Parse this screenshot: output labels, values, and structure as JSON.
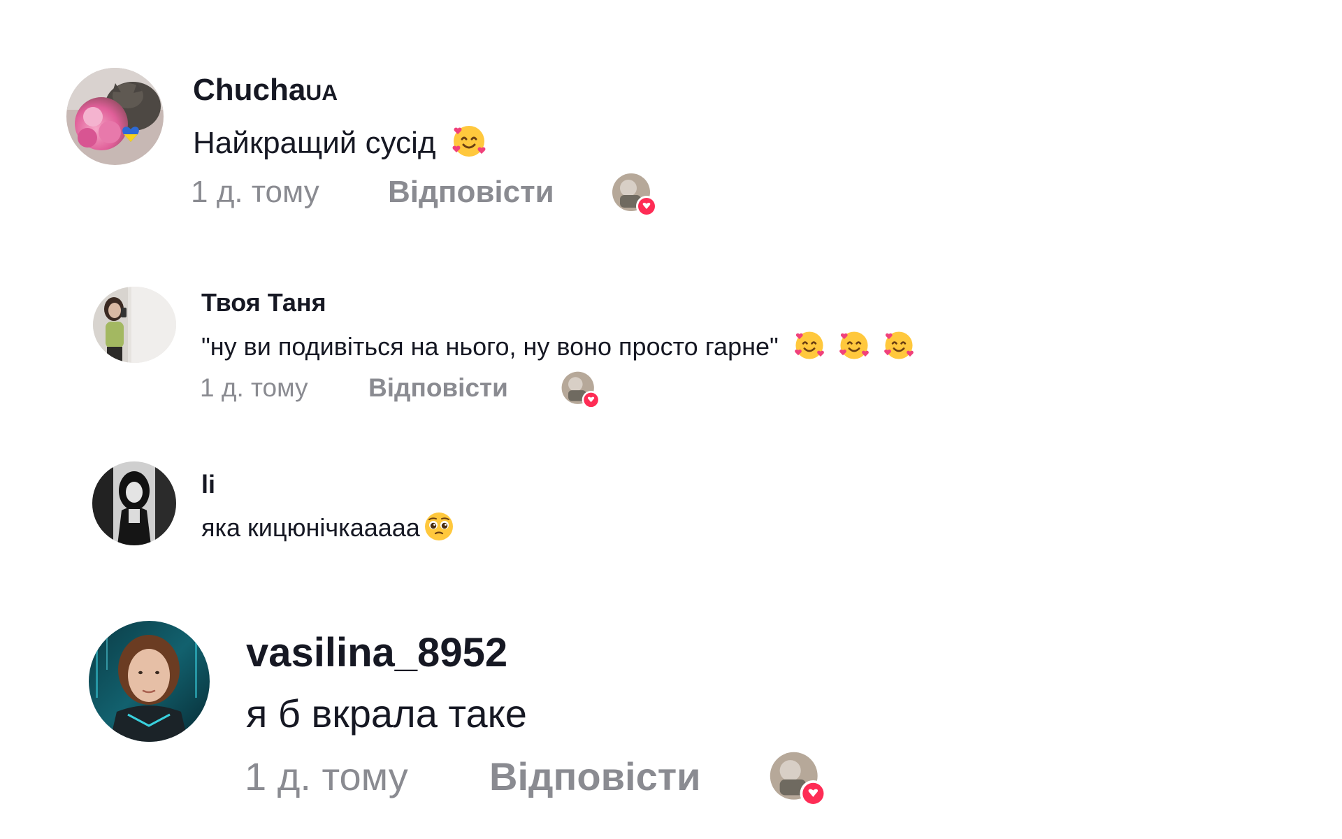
{
  "comments": [
    {
      "username": "Chucha",
      "username_suffix": "UA",
      "text": "Найкращий сусід",
      "emoji": [
        "smiling-face-with-hearts"
      ],
      "time": "1 д. тому",
      "reply_label": "Відповісти",
      "avatar": "cat-with-flowers-and-ukrainian-heart"
    },
    {
      "username": "Твоя Таня",
      "text": "\"ну ви подивіться на нього, ну воно просто гарне\"",
      "emoji": [
        "smiling-face-with-hearts",
        "smiling-face-with-hearts",
        "smiling-face-with-hearts"
      ],
      "time": "1 д. тому",
      "reply_label": "Відповісти",
      "avatar": "girl-mirror-selfie"
    },
    {
      "username": "li",
      "text": "яка кицюнічкааааа",
      "emoji": [
        "pleading-face"
      ],
      "avatar": "black-and-white-portrait"
    },
    {
      "username": "vasilina_8952",
      "text": "я б вкрала таке",
      "time": "1 д. тому",
      "reply_label": "Відповісти",
      "avatar": "woman-portrait-cyber"
    }
  ],
  "creator_like_badge": {
    "icon": "creator-liked-heart-icon",
    "heart_color": "#fe2c55"
  }
}
